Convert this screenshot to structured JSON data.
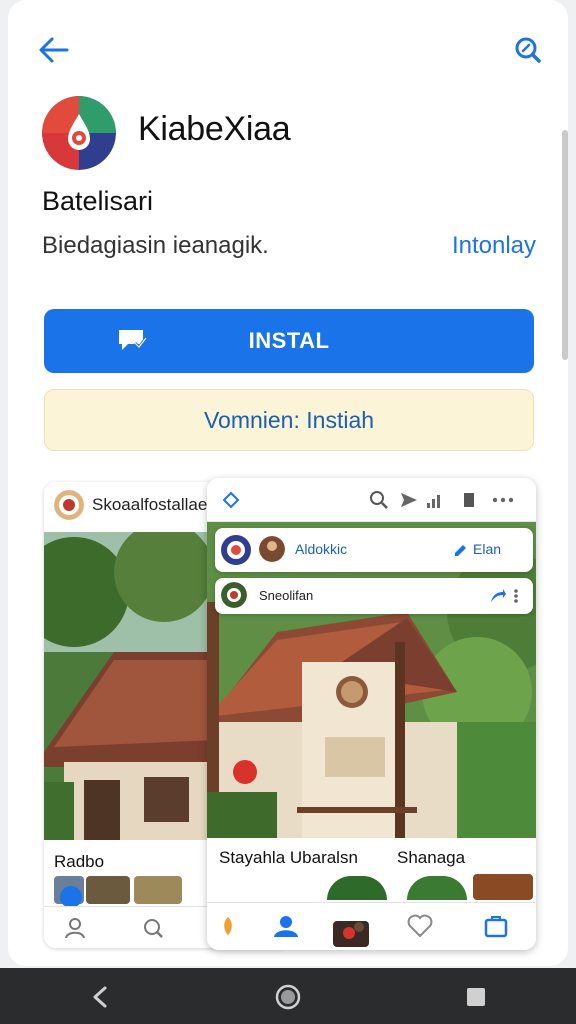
{
  "app": {
    "name": "KiabeXiaa",
    "developer": "Batelisari",
    "description": "Biedagiasin ieanagik.",
    "description_link": "Intonlay"
  },
  "actions": {
    "install_label": "INSTAL",
    "notice_text": "Vomnien: Instiah"
  },
  "screenshot_left": {
    "title": "Skoaalfostallae",
    "caption": "Radbo"
  },
  "screenshot_right": {
    "card1_name": "Aldokkic",
    "card1_action": "Elan",
    "card2_name": "Sneolifan",
    "captions": [
      "Stayahla Ubaralsn",
      "Shanaga"
    ]
  },
  "colors": {
    "accent": "#1a73e8",
    "notice_bg": "#fbf4d6",
    "notice_text": "#1a5fb4",
    "system_nav": "#2b2c2e"
  },
  "icons": {
    "back": "arrow-left-icon",
    "search": "search-icon",
    "install": "install-device-icon",
    "nav": [
      "person-icon",
      "search-icon",
      "home-icon",
      "heart-icon",
      "bag-icon"
    ],
    "system": [
      "back-triangle-icon",
      "home-circle-icon",
      "recents-square-icon"
    ]
  }
}
